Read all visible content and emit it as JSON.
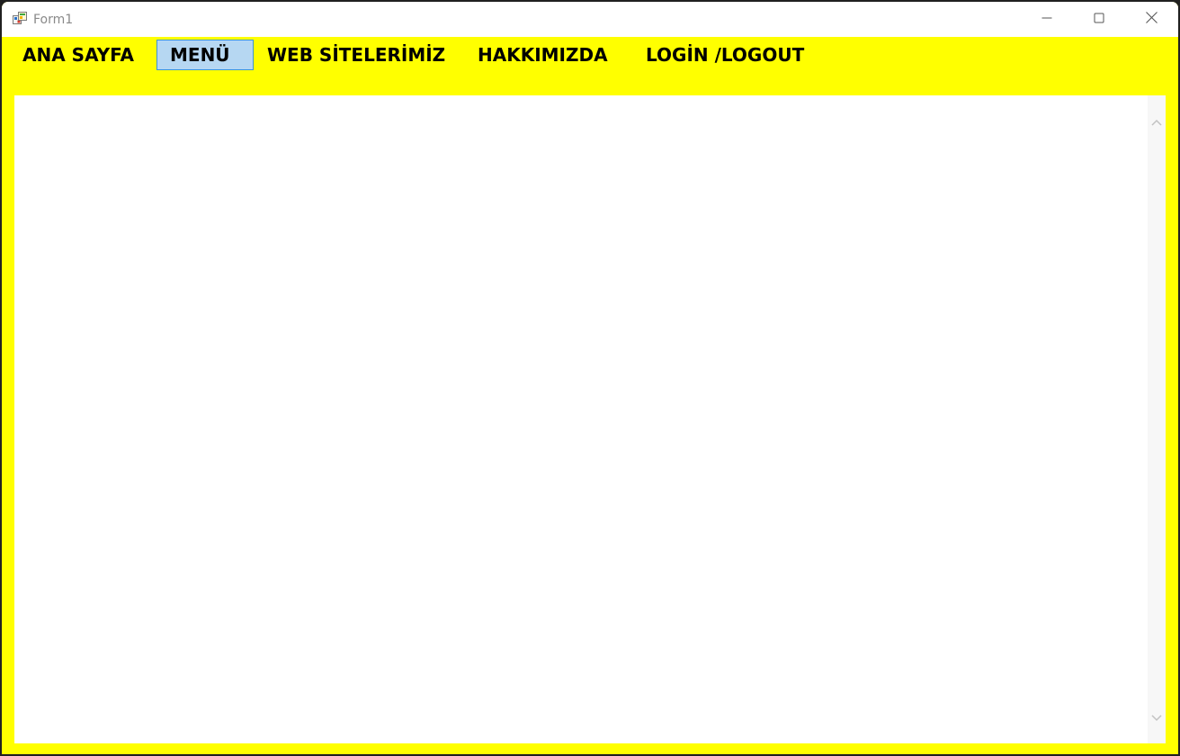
{
  "window": {
    "title": "Form1",
    "icon": "winforms-app-icon",
    "accent_color": "#ffff00"
  },
  "caption_buttons": {
    "minimize_icon": "minimize-icon",
    "maximize_icon": "maximize-icon",
    "close_icon": "close-icon"
  },
  "menu": {
    "items": [
      {
        "label": "ANA SAYFA",
        "selected": false
      },
      {
        "label": "MENÜ",
        "selected": true
      },
      {
        "label": "WEB SİTELERİMİZ",
        "selected": false
      },
      {
        "label": "HAKKIMIZDA",
        "selected": false
      },
      {
        "label": "LOGİN /LOGOUT",
        "selected": false
      }
    ],
    "selected_background": "#b6d7f2",
    "selected_border": "#3c94d9"
  },
  "content": {
    "background": "#ffffff",
    "scrollbar": {
      "up_icon": "chevron-up-icon",
      "down_icon": "chevron-down-icon"
    }
  }
}
